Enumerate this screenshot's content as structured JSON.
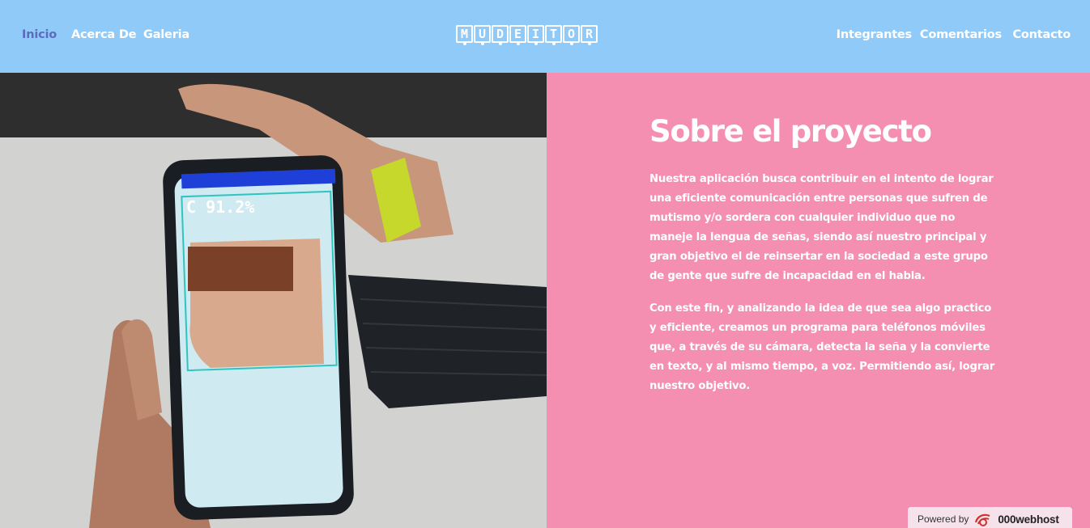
{
  "nav": {
    "left": [
      "Inicio",
      "Acerca De",
      "Galeria"
    ],
    "right": [
      "Integrantes",
      "Comentarios",
      "Contacto"
    ],
    "active_color": "#5c6bc0",
    "background": "#90caf9"
  },
  "logo": {
    "letters": [
      "M",
      "U",
      "D",
      "E",
      "I",
      "T",
      "O",
      "R"
    ]
  },
  "photo": {
    "phone_overlay_text": "C 91.2%"
  },
  "section": {
    "title": "Sobre el proyecto",
    "paragraph_1": "Nuestra aplicación busca contribuir en el intento de lograr una eficiente comunicación entre personas que sufren de mutismo y/o sordera con cualquier individuo que no maneje la lengua de señas, siendo así nuestro principal y gran objetivo el de reinsertar en la sociedad a este grupo de gente que sufre de incapacidad en el habla.",
    "paragraph_2": "Con este fin, y analizando la idea de que sea algo practico y eficiente, creamos un programa para teléfonos móviles que, a través de su cámara, detecta la seña y la convierte en texto, y al mismo tiempo, a voz. Permitiendo así, lograr nuestro objetivo.",
    "background": "#f48fb1"
  },
  "badge": {
    "prefix": "Powered by",
    "brand": "000webhost"
  }
}
